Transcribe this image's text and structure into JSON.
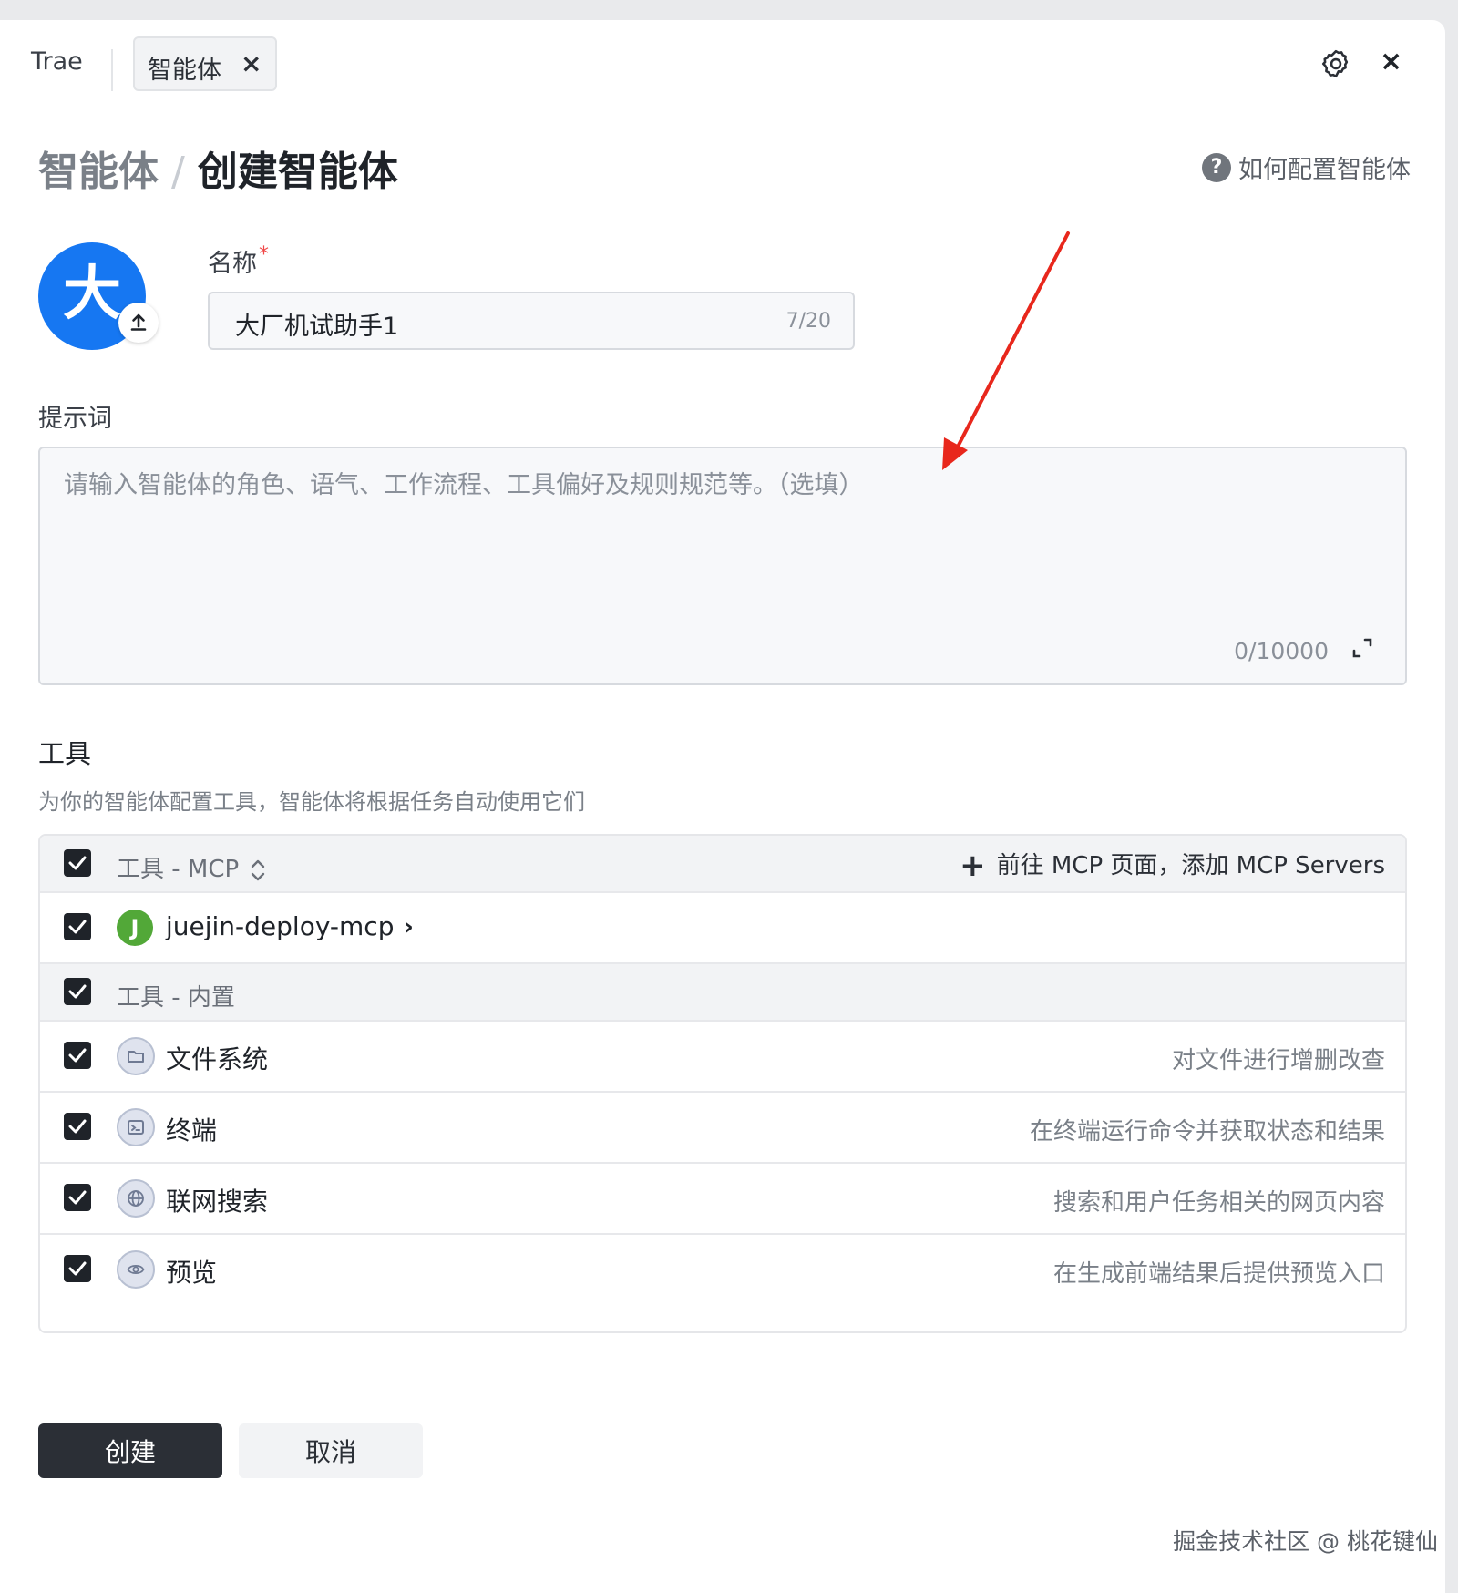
{
  "colors": {
    "primary_button": "#2b2f36",
    "avatar_bg": "#1677f2",
    "mcp_avatar_bg": "#52a838",
    "required": "#f04848",
    "annotation_arrow": "#e8271c"
  },
  "topbar": {
    "app_name": "Trae",
    "tab_label": "智能体",
    "tab_close_glyph": "×",
    "close_glyph": "×",
    "icons": [
      "gear-icon",
      "close-icon"
    ]
  },
  "header": {
    "breadcrumb_parent": "智能体",
    "breadcrumb_separator": "/",
    "breadcrumb_current": "创建智能体",
    "help_icon_glyph": "?",
    "help_text": "如何配置智能体"
  },
  "avatar": {
    "letter": "大",
    "upload_icon": "upload-icon"
  },
  "name_field": {
    "label": "名称",
    "required_mark": "*",
    "value": "大厂机试助手1",
    "counter": "7/20"
  },
  "prompt_field": {
    "label": "提示词",
    "placeholder": "请输入智能体的角色、语气、工作流程、工具偏好及规则规范等。（选填）",
    "counter": "0/10000",
    "expand_icon": "expand-icon"
  },
  "tools": {
    "label": "工具",
    "description": "为你的智能体配置工具，智能体将根据任务自动使用它们",
    "mcp_group": {
      "title": "工具 - MCP",
      "checked": true,
      "add_link": "前往 MCP 页面，添加 MCP Servers",
      "add_icon": "+"
    },
    "mcp_items": [
      {
        "avatar_letter": "J",
        "name": "juejin-deploy-mcp",
        "chevron": "›",
        "checked": true
      }
    ],
    "builtin_group": {
      "title": "工具 - 内置",
      "checked": true
    },
    "builtin_items": [
      {
        "name": "文件系统",
        "description": "对文件进行增删改查",
        "icon": "folder-icon",
        "checked": true
      },
      {
        "name": "终端",
        "description": "在终端运行命令并获取状态和结果",
        "icon": "terminal-icon",
        "checked": true
      },
      {
        "name": "联网搜索",
        "description": "搜索和用户任务相关的网页内容",
        "icon": "globe-icon",
        "checked": true
      },
      {
        "name": "预览",
        "description": "在生成前端结果后提供预览入口",
        "icon": "eye-icon",
        "checked": true
      }
    ]
  },
  "actions": {
    "create_label": "创建",
    "cancel_label": "取消"
  },
  "watermark": "掘金技术社区 @ 桃花键仙"
}
